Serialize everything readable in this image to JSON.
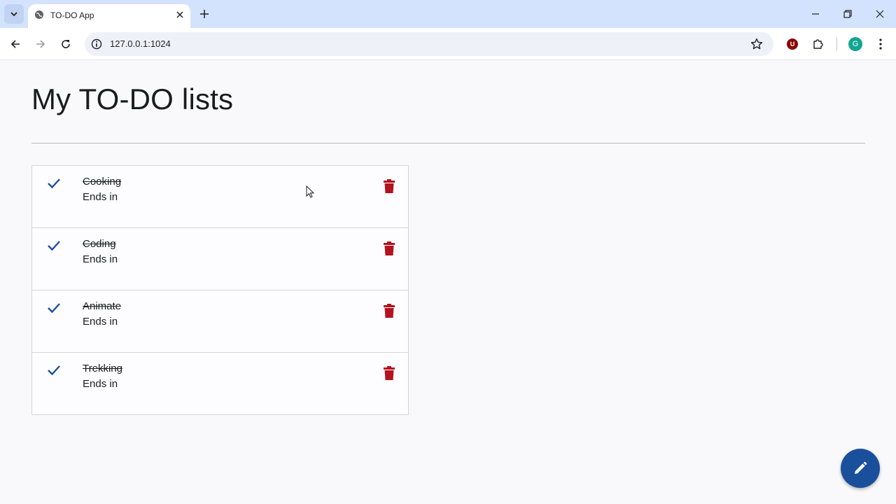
{
  "browser": {
    "tab_title": "TO-DO App",
    "url": "127.0.0.1:1024",
    "extension_badge": "U",
    "profile_initial": "G"
  },
  "page": {
    "title": "My TO-DO lists",
    "items": [
      {
        "name": "Cooking",
        "subtitle": "Ends in",
        "done": true
      },
      {
        "name": "Coding",
        "subtitle": "Ends in",
        "done": true
      },
      {
        "name": "Animate",
        "subtitle": "Ends in",
        "done": true
      },
      {
        "name": "Trekking",
        "subtitle": "Ends in",
        "done": true
      }
    ]
  },
  "colors": {
    "check": "#1a4f9c",
    "delete": "#b3121f",
    "fab": "#1a4f9c"
  },
  "icons": [
    "tab-search-icon",
    "globe-icon",
    "close-icon",
    "plus-icon",
    "minimize-icon",
    "restore-icon",
    "back-icon",
    "forward-icon",
    "reload-icon",
    "site-info-icon",
    "star-icon",
    "puzzle-icon",
    "menu-dots-icon",
    "check-icon",
    "trash-icon",
    "pencil-icon"
  ]
}
